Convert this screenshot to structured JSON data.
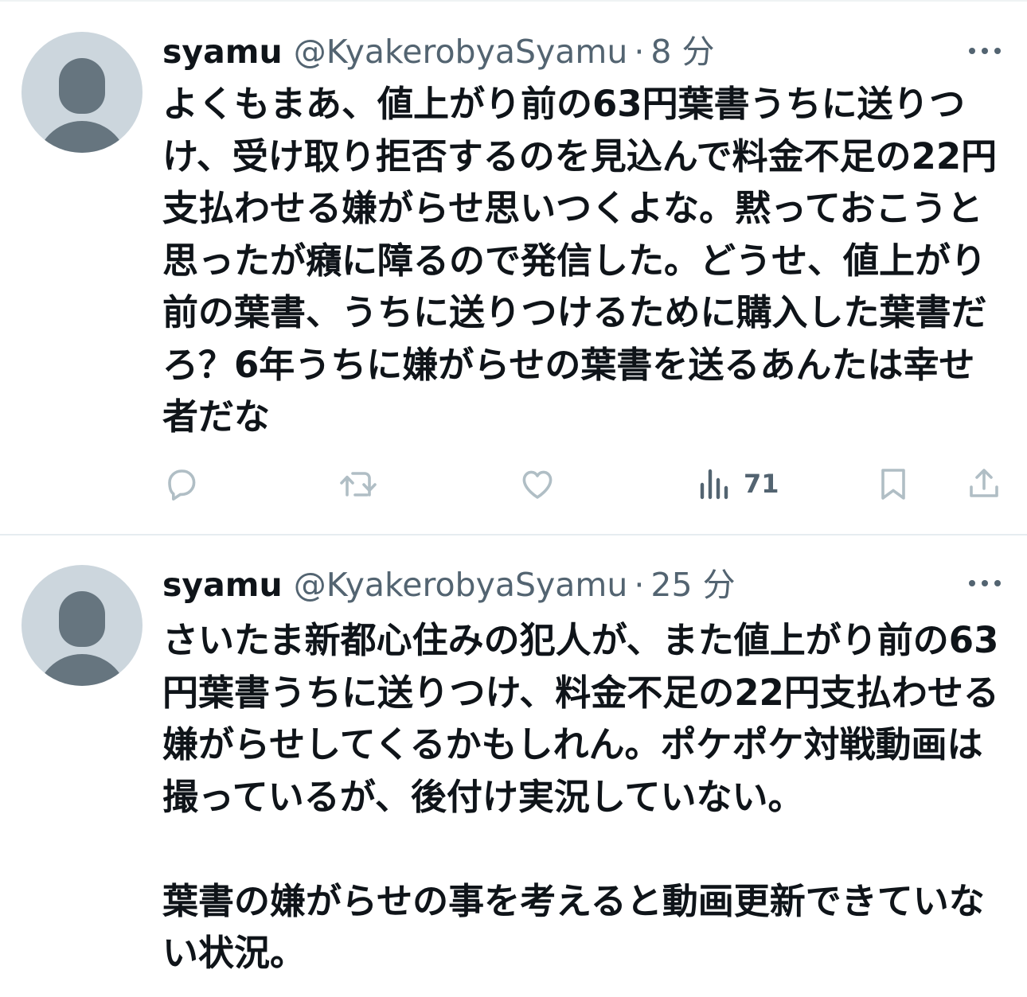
{
  "tweets": [
    {
      "user": {
        "name": "syamu",
        "handle": "@KyakerobyaSyamu"
      },
      "separator": "·",
      "time": "8 分",
      "text": "よくもまあ、値上がり前の63円葉書うちに送りつけ、受け取り拒否するのを見込んで料金不足の22円支払わせる嫌がらせ思いつくよな。黙っておこうと思ったが癪に障るので発信した。どうせ、値上がり前の葉書、うちに送りつけるために購入した葉書だろ？6年うちに嫌がらせの葉書を送るあんたは幸せ者だな",
      "actions": {
        "views_count": "71"
      }
    },
    {
      "user": {
        "name": "syamu",
        "handle": "@KyakerobyaSyamu"
      },
      "separator": "·",
      "time": "25 分",
      "text": "さいたま新都心住みの犯人が、また値上がり前の63円葉書うちに送りつけ、料金不足の22円支払わせる嫌がらせしてくるかもしれん。ポケポケ対戦動画は撮っているが、後付け実況していない。\n\n葉書の嫌がらせの事を考えると動画更新できていない状況。"
    }
  ],
  "icons": {
    "avatar": "default-profile-avatar",
    "more": "more-dots-icon",
    "reply": "reply-icon",
    "retweet": "retweet-icon",
    "like": "heart-icon",
    "views": "views-chart-icon",
    "bookmark": "bookmark-icon",
    "share": "share-icon"
  },
  "colors": {
    "text_primary": "#0f1419",
    "text_secondary": "#536471",
    "avatar_bg": "#ccd6dd",
    "avatar_fg": "#66757f",
    "separator": "#e6ecf0",
    "action_icon": "#b0bec5"
  }
}
